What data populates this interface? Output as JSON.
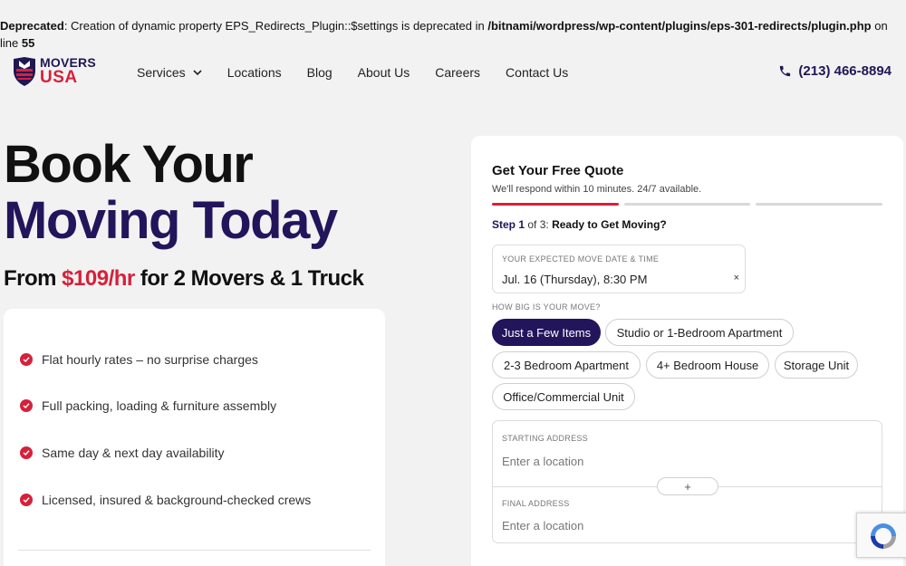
{
  "notice": {
    "label": "Deprecated",
    "text_a": ": Creation of dynamic property EPS_Redirects_Plugin::$settings is deprecated in ",
    "path": "/bitnami/wordpress/wp-content/plugins/eps-301-redirects/plugin.php",
    "text_b": " on line ",
    "line": "55"
  },
  "brand": {
    "line1": "MOVERS",
    "line2": "USA",
    "colors": {
      "navy": "#1f1754",
      "red": "#d6213b"
    }
  },
  "nav": {
    "items": [
      {
        "label": "Services",
        "has_dropdown": true
      },
      {
        "label": "Locations"
      },
      {
        "label": "Blog"
      },
      {
        "label": "About Us"
      },
      {
        "label": "Careers"
      },
      {
        "label": "Contact Us"
      }
    ]
  },
  "phone": {
    "number": "(213) 466-8894",
    "icon": "phone-icon"
  },
  "hero": {
    "line1": "Book Your",
    "line2": "Moving Today",
    "sub_prefix": "From ",
    "sub_price": "$109/hr",
    "sub_suffix": " for 2 Movers & 1 Truck"
  },
  "benefits": [
    "Flat hourly rates – no surprise charges",
    "Full packing, loading & furniture assembly",
    "Same day & next day availability",
    "Licensed, insured & background-checked crews"
  ],
  "quote": {
    "title": "Get Your Free Quote",
    "subtitle": "We'll respond within 10 minutes. 24/7 available.",
    "progress": {
      "current": 1,
      "total": 3
    },
    "step_word": "Step ",
    "step_num": "1",
    "step_of": " of 3: ",
    "step_title": "Ready to Get Moving?",
    "date_label": "YOUR EXPECTED MOVE DATE & TIME",
    "date_value": "Jul. 16 (Thursday), 8:30 PM",
    "clear_glyph": "×",
    "size_label": "HOW BIG IS YOUR MOVE?",
    "size_options": [
      {
        "label": "Just a Few Items",
        "selected": true
      },
      {
        "label": "Studio or 1-Bedroom Apartment"
      },
      {
        "label": "2-3 Bedroom Apartment"
      },
      {
        "label": "4+ Bedroom House"
      },
      {
        "label": "Storage Unit"
      },
      {
        "label": "Office/Commercial Unit"
      }
    ],
    "start_label": "STARTING ADDRESS",
    "start_placeholder": "Enter a location",
    "add_glyph": "+",
    "final_label": "FINAL ADDRESS",
    "final_placeholder": "Enter a location"
  }
}
